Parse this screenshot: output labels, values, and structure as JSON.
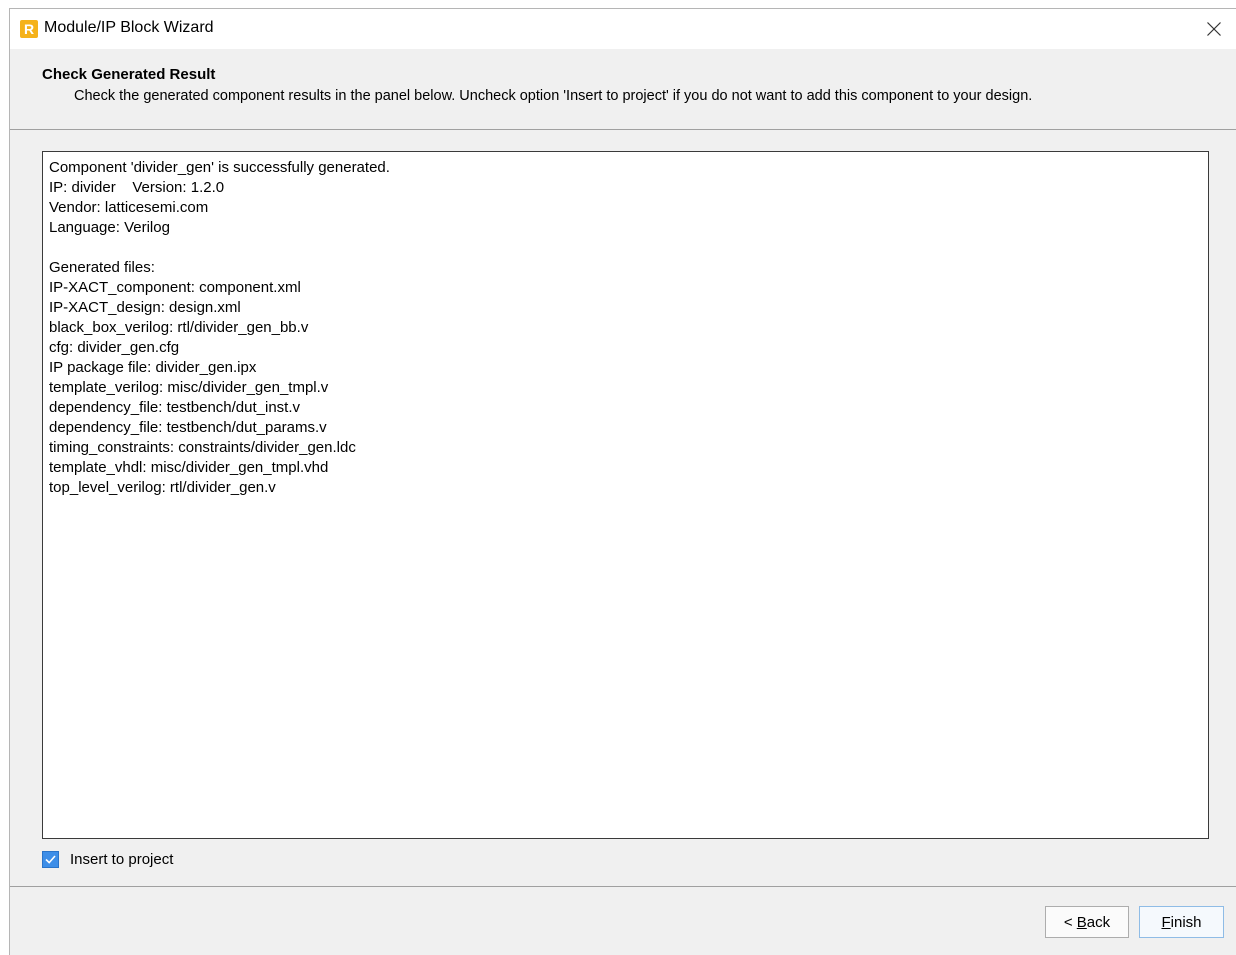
{
  "window": {
    "title": "Module/IP Block Wizard",
    "app_icon_letter": "R",
    "app_icon_color": "#f5b21a",
    "close_icon": "close-icon"
  },
  "header": {
    "title": "Check Generated Result",
    "description": "Check the generated component results in the panel below. Uncheck option 'Insert to project' if you do not want to add this component to your design."
  },
  "result_panel": {
    "lines": [
      "Component 'divider_gen' is successfully generated.",
      "IP: divider    Version: 1.2.0",
      "Vendor: latticesemi.com",
      "Language: Verilog",
      "",
      "Generated files:",
      "IP-XACT_component: component.xml",
      "IP-XACT_design: design.xml",
      "black_box_verilog: rtl/divider_gen_bb.v",
      "cfg: divider_gen.cfg",
      "IP package file: divider_gen.ipx",
      "template_verilog: misc/divider_gen_tmpl.v",
      "dependency_file: testbench/dut_inst.v",
      "dependency_file: testbench/dut_params.v",
      "timing_constraints: constraints/divider_gen.ldc",
      "template_vhdl: misc/divider_gen_tmpl.vhd",
      "top_level_verilog: rtl/divider_gen.v"
    ]
  },
  "insert_option": {
    "label": "Insert to project",
    "checked": true,
    "accent_color": "#3d8ee8"
  },
  "buttons": {
    "back_prefix": "< ",
    "back_mnemonic": "B",
    "back_rest": "ack",
    "finish_mnemonic": "F",
    "finish_rest": "inish"
  }
}
